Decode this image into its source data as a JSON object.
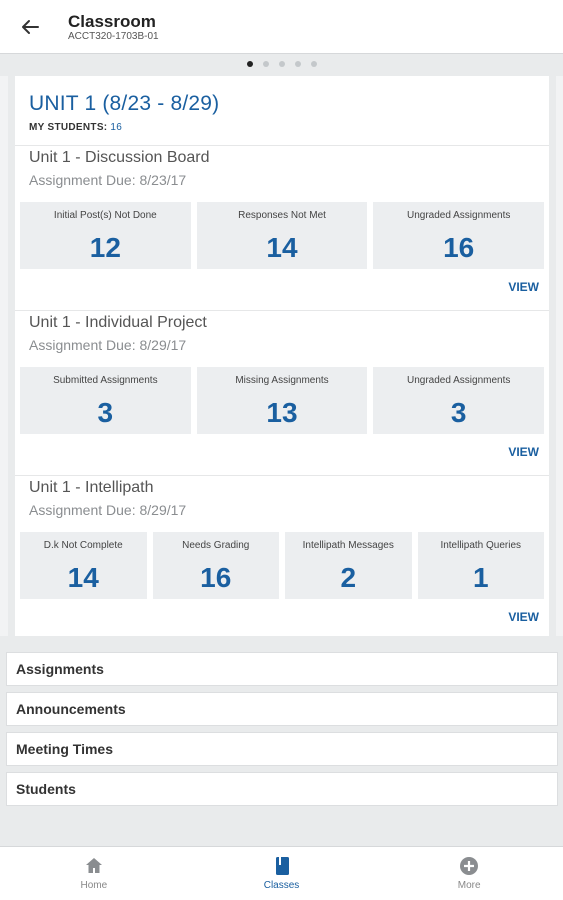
{
  "appbar": {
    "title": "Classroom",
    "subtitle": "ACCT320-1703B-01"
  },
  "unit": {
    "title": "UNIT 1 (8/23 - 8/29)",
    "students_label": "MY STUDENTS:",
    "students_count": "16",
    "sections": [
      {
        "title": "Unit 1 - Discussion Board",
        "due": "Assignment Due: 8/23/17",
        "stats": [
          {
            "label": "Initial Post(s) Not Done",
            "value": "12"
          },
          {
            "label": "Responses Not Met",
            "value": "14"
          },
          {
            "label": "Ungraded Assignments",
            "value": "16"
          }
        ],
        "view_label": "VIEW"
      },
      {
        "title": "Unit 1 - Individual Project",
        "due": "Assignment Due: 8/29/17",
        "stats": [
          {
            "label": "Submitted Assignments",
            "value": "3"
          },
          {
            "label": "Missing Assignments",
            "value": "13"
          },
          {
            "label": "Ungraded Assignments",
            "value": "3"
          }
        ],
        "view_label": "VIEW"
      },
      {
        "title": "Unit 1 - Intellipath",
        "due": "Assignment Due: 8/29/17",
        "stats": [
          {
            "label": "D.k Not Complete",
            "value": "14"
          },
          {
            "label": "Needs Grading",
            "value": "16"
          },
          {
            "label": "Intellipath Messages",
            "value": "2"
          },
          {
            "label": "Intellipath Queries",
            "value": "1"
          }
        ],
        "view_label": "VIEW"
      }
    ]
  },
  "menu": [
    "Assignments",
    "Announcements",
    "Meeting Times",
    "Students"
  ],
  "nav": [
    {
      "label": "Home",
      "icon": "home-icon"
    },
    {
      "label": "Classes",
      "icon": "book-icon"
    },
    {
      "label": "More",
      "icon": "plus-circle-icon"
    }
  ],
  "colors": {
    "accent": "#1a5fa0",
    "tile_bg": "#eceef0",
    "page_bg": "#e9ebec"
  },
  "pager": {
    "pages": 5,
    "current": 1
  }
}
